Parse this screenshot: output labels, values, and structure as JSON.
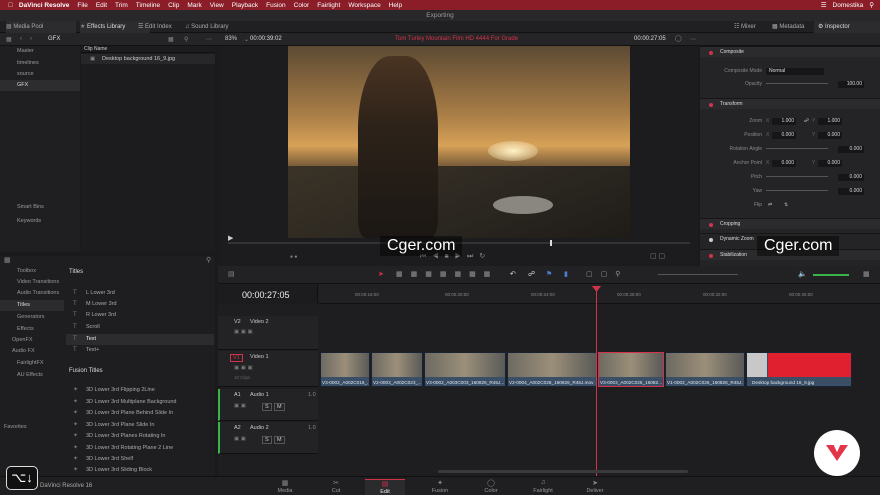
{
  "menubar": {
    "app": "DaVinci Resolve",
    "items": [
      "File",
      "Edit",
      "Trim",
      "Timeline",
      "Clip",
      "Mark",
      "View",
      "Playback",
      "Fusion",
      "Color",
      "Fairlight",
      "Workspace",
      "Help"
    ],
    "user": "Domestika"
  },
  "window": {
    "title": "Exporting"
  },
  "toolbar": {
    "media_pool": "Media Pool",
    "effects_library": "Effects Library",
    "edit_index": "Edit Index",
    "sound_library": "Sound Library",
    "mixer": "Mixer",
    "metadata": "Metadata",
    "inspector": "Inspector"
  },
  "bins": {
    "current": "GFX",
    "column_header": "Clip Name",
    "tree": [
      "Master",
      "timelines",
      "source",
      "GFX"
    ],
    "clip": "Desktop background 16_9.jpg",
    "smart_bins": "Smart Bins",
    "keywords": "Keywords"
  },
  "viewer": {
    "zoom": "83%",
    "source_tc": "00:00:39:02",
    "timeline_name": "Tom Turley Mountain Film HD 4444 For Grade",
    "record_tc": "00:00:27:05",
    "title": "Exporting"
  },
  "inspector": {
    "composite": "Composite",
    "composite_mode_label": "Composite Mode",
    "composite_mode": "Normal",
    "opacity_label": "Opacity",
    "opacity": "100.00",
    "transform": "Transform",
    "zoom_label": "Zoom",
    "zoom_x": "1.000",
    "zoom_y": "1.000",
    "position_label": "Position",
    "pos_x": "0.000",
    "pos_y": "0.000",
    "rotation_label": "Rotation Angle",
    "rotation": "0.000",
    "anchor_label": "Anchor Point",
    "anchor_x": "0.000",
    "anchor_y": "0.000",
    "pitch_label": "Pitch",
    "pitch": "0.000",
    "yaw_label": "Yaw",
    "yaw": "0.000",
    "flip_label": "Flip",
    "cropping": "Cropping",
    "dynamic_zoom": "Dynamic Zoom",
    "stabilization": "Stabilization",
    "x": "X",
    "y": "Y"
  },
  "effects": {
    "tree": [
      "Toolbox",
      "Video Transitions",
      "Audio Transitions",
      "Titles",
      "Generators",
      "Effects",
      "OpenFX",
      "Audio FX",
      "FairlightFX",
      "AU Effects"
    ],
    "favorites": "Favorites",
    "titles_header": "Titles",
    "titles": [
      "L Lower 3rd",
      "M Lower 3rd",
      "R Lower 3rd",
      "Scroll",
      "Text",
      "Text+"
    ],
    "fusion_header": "Fusion Titles",
    "fusion_titles": [
      "3D Lower 3rd Flipping 2Line",
      "3D Lower 3rd Multiplane Background",
      "3D Lower 3rd Plane Behind Slide In",
      "3D Lower 3rd Plane Slide In",
      "3D Lower 3rd Planes Rotating In",
      "3D Lower 3rd Rotating Plane 2 Line",
      "3D Lower 3rd Shelf",
      "3D Lower 3rd Sliding Block"
    ]
  },
  "timeline": {
    "timecode": "00:00:27:05",
    "ruler": [
      "00:00:16:00",
      "00:00:20:00",
      "00:00:24:00",
      "00:00:28:00",
      "00:00:32:00",
      "00:00:36:00"
    ],
    "tracks": {
      "v2": "V2",
      "v2_name": "Video 2",
      "v1": "V1",
      "v1_name": "Video 1",
      "v1_clips": "10 Clips",
      "a1": "A1",
      "a1_name": "Audio 1",
      "a1_ch": "1.0",
      "a2": "A2",
      "a2_name": "Audio 2",
      "a2_ch": "1.0",
      "s": "S",
      "m": "M"
    },
    "clips": [
      "V3-0002_A002C016_...",
      "V2-0003_A002C023_...",
      "V3-0002_A003C003_160826_R45J...",
      "V2-0004_A002C028_160826_R45J.mov",
      "V3-0003_A002C025_16082...",
      "V1-0002_A002C026_160826_R45J.mov",
      "Desktop background 16_9.jpg"
    ]
  },
  "pages": [
    "Media",
    "Cut",
    "Edit",
    "Fusion",
    "Color",
    "Fairlight",
    "Deliver"
  ],
  "active_page": "Edit",
  "footer": {
    "product": "DaVinci Resolve 16"
  },
  "watermark": "Cger.com",
  "colors": {
    "accent": "#d2334a",
    "clip": "#3a4e66",
    "menubar": "#8a1d28"
  }
}
